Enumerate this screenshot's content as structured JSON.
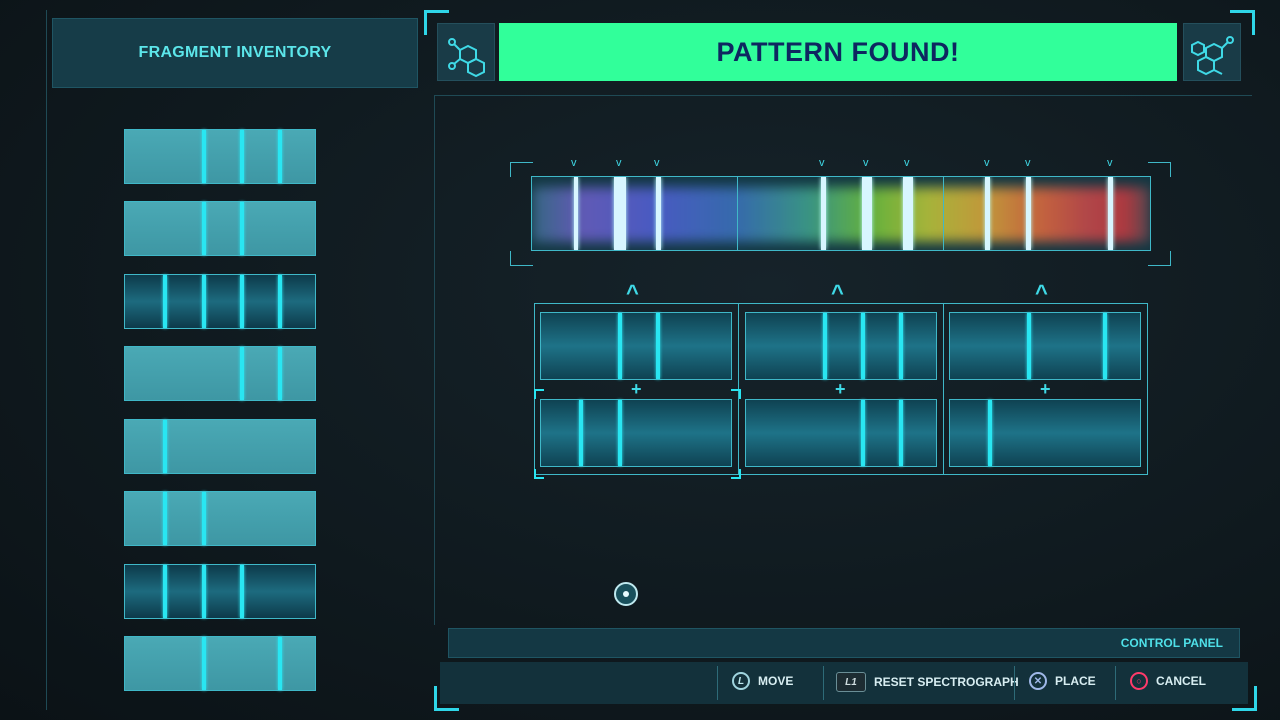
{
  "inventory": {
    "title": "FRAGMENT INVENTORY"
  },
  "header": {
    "status": "PATTERN FOUND!",
    "left_icon": "molecule-icon",
    "right_icon": "molecule-icon"
  },
  "control_panel": {
    "title": "CONTROL PANEL",
    "actions": [
      {
        "button": "L",
        "label": "MOVE",
        "icon": "left-stick-icon"
      },
      {
        "button": "L1",
        "label": "RESET SPECTROGRAPH",
        "icon": "l1-button-icon"
      },
      {
        "button": "✕",
        "label": "PLACE",
        "icon": "cross-button-icon"
      },
      {
        "button": "○",
        "label": "CANCEL",
        "icon": "circle-button-icon"
      }
    ]
  },
  "colors": {
    "banner": "#31ff9a",
    "accent": "#29e6f2",
    "banner_text": "#0e2760"
  }
}
